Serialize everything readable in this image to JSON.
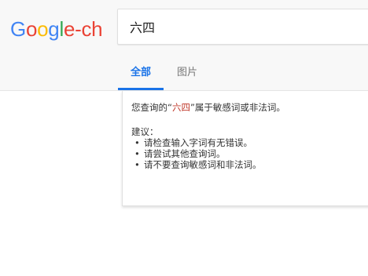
{
  "logo": {
    "parts": [
      "G",
      "o",
      "o",
      "g",
      "l",
      "e",
      "-ch"
    ],
    "colors": [
      "#4285f4",
      "#ea4335",
      "#fbbc05",
      "#4285f4",
      "#34a853",
      "#ea4335",
      "#ea4335"
    ]
  },
  "search": {
    "value": "六四"
  },
  "tabs": [
    {
      "label": "全部",
      "active": true
    },
    {
      "label": "图片",
      "active": false
    }
  ],
  "notice": {
    "prefix": "您查询的“",
    "query": "六四",
    "suffix": "”属于敏感词或非法词。",
    "suggestions_title": "建议：",
    "suggestions": [
      "请检查输入字词有无错误。",
      "请尝试其他查询词。",
      "请不要查询敏感词和非法词。"
    ]
  }
}
